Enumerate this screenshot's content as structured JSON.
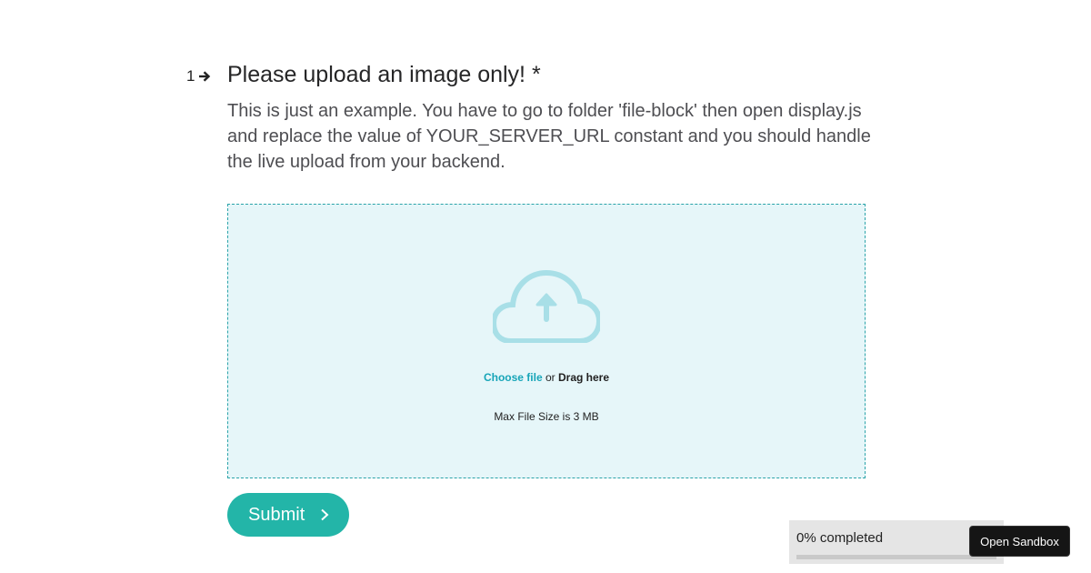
{
  "question": {
    "number": "1",
    "title": "Please upload an image only! *",
    "description": "This is just an example. You have to go to folder 'file-block' then open display.js and replace the value of YOUR_SERVER_URL constant and you should handle the live upload from your backend."
  },
  "upload": {
    "icon": "cloud-upload-icon",
    "choose_label": "Choose file",
    "or_text": "or",
    "drag_label": "Drag here",
    "max_size_text": "Max File Size is 3 MB"
  },
  "submit": {
    "label": "Submit"
  },
  "progress": {
    "label": "0% completed",
    "value": 0
  },
  "sandbox": {
    "label": "Open Sandbox"
  },
  "colors": {
    "accent": "#23b5a8",
    "link": "#17a5b8",
    "dropzone_bg": "#e6f6f9",
    "dropzone_border": "#2aa3a9",
    "cloud": "#a8dfe7"
  }
}
